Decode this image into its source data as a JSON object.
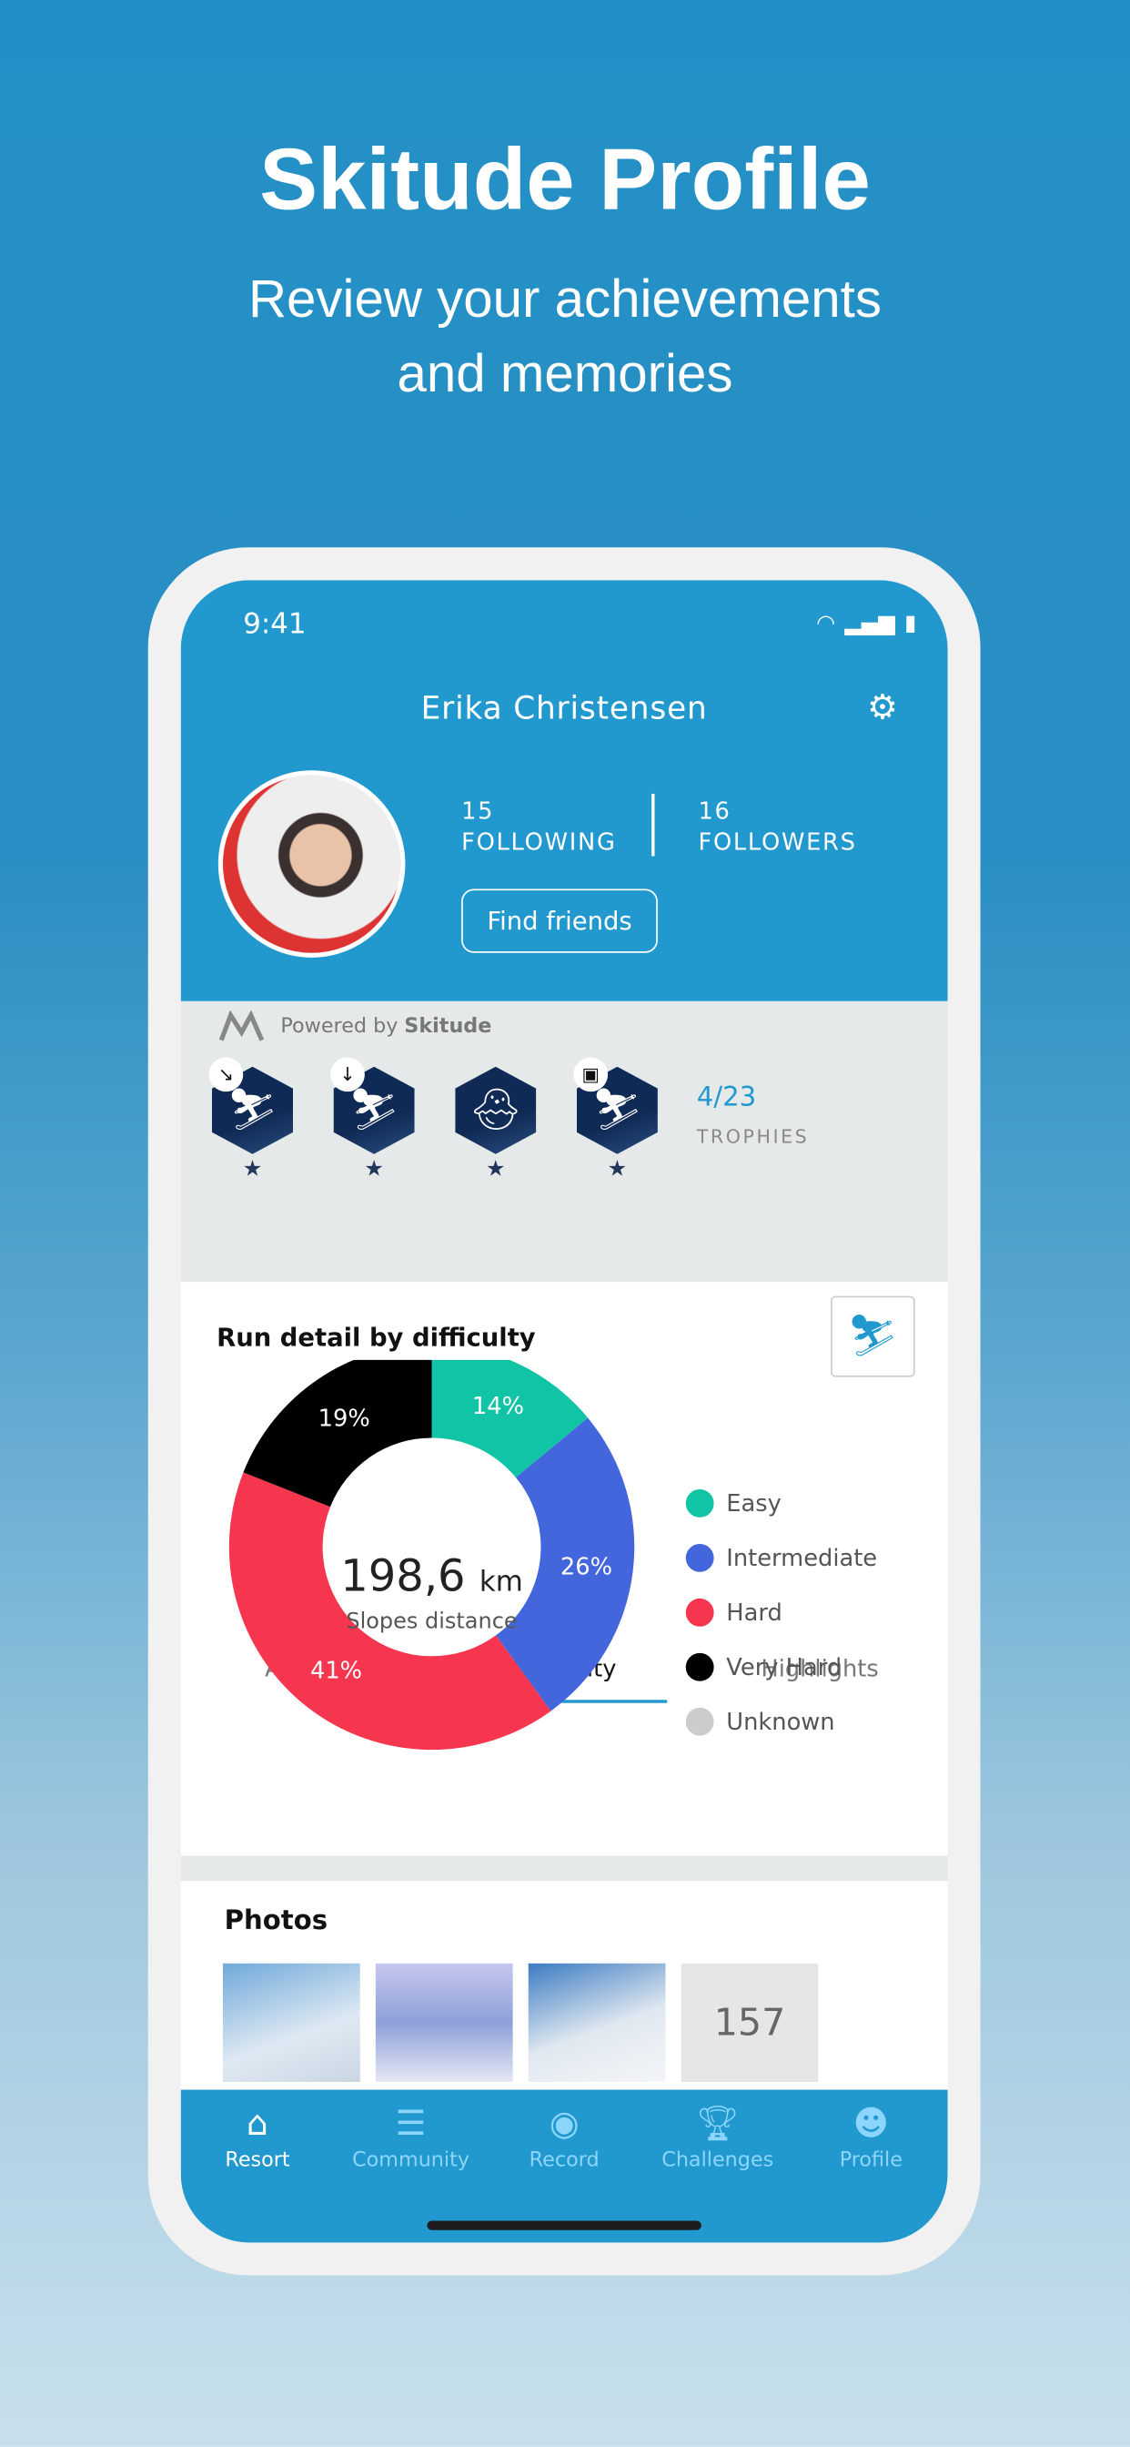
{
  "hero": {
    "title": "Skitude Profile",
    "subtitle_line1": "Review your achievements",
    "subtitle_line2": "and memories"
  },
  "status_bar": {
    "time": "9:41"
  },
  "profile": {
    "name": "Erika Christensen",
    "following_count": "15",
    "following_label": "FOLLOWING",
    "followers_count": "16",
    "followers_label": "FOLLOWERS",
    "find_friends": "Find friends"
  },
  "powered": {
    "prefix": "Powered by",
    "brand": "Skitude"
  },
  "trophies": {
    "count": "4/23",
    "label": "TROPHIES",
    "badges": [
      {
        "icon": "skier-icon",
        "mini": "↘"
      },
      {
        "icon": "skier-icon",
        "mini": "↓"
      },
      {
        "icon": "chick-icon",
        "mini": ""
      },
      {
        "icon": "skier-icon",
        "mini": "▣"
      }
    ]
  },
  "tabs": [
    "Activity",
    "Difficulty",
    "Highlights"
  ],
  "chart_data": {
    "type": "pie",
    "title": "Run detail by difficulty",
    "categories": [
      "Easy",
      "Intermediate",
      "Hard",
      "Very Hard",
      "Unknown"
    ],
    "values": [
      14,
      26,
      41,
      19,
      0
    ],
    "labels": [
      "14%",
      "26%",
      "41%",
      "19%",
      ""
    ],
    "colors": [
      "#12c4a6",
      "#4466dd",
      "#f5364e",
      "#000000",
      "#cccccc"
    ],
    "center_value": "198,6",
    "center_unit": "km",
    "center_label": "Slopes distance",
    "legend": "right"
  },
  "photos": {
    "title": "Photos",
    "more": "157"
  },
  "nav": [
    "Resort",
    "Community",
    "Record",
    "Challenges",
    "Profile"
  ]
}
